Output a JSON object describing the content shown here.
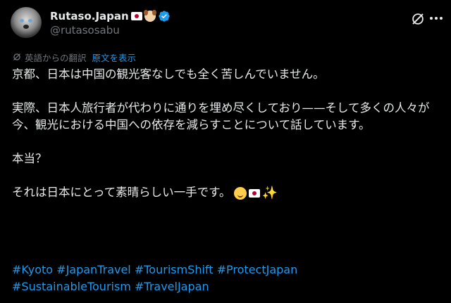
{
  "author": {
    "display_name": "Rutaso.Japan",
    "handle": "@rutasosabu",
    "name_icons": [
      "japan-flag",
      "dog-face",
      "verified-badge"
    ]
  },
  "translation": {
    "label": "英語からの翻訳",
    "show_original": "原文を表示"
  },
  "post": {
    "lines": [
      "京都、日本は中国の観光客なしでも全く苦しんでいません。",
      "実際、日本人旅行者が代わりに通りを埋め尽くしており——そして多くの人々が今、観光における中国への依存を減らすことについて話しています。",
      "本当？",
      "それは日本にとって素晴らしい一手です。"
    ],
    "trailing_emojis": [
      "smiling-face",
      "japan-flag",
      "sparkles"
    ]
  },
  "hashtags": [
    "#Kyoto",
    "#JapanTravel",
    "#TourismShift",
    "#ProtectJapan",
    "#SustainableTourism",
    "#TravelJapan"
  ],
  "colors": {
    "background": "#000000",
    "text": "#e7e9ea",
    "secondary": "#71767b",
    "link": "#1d9bf0"
  }
}
